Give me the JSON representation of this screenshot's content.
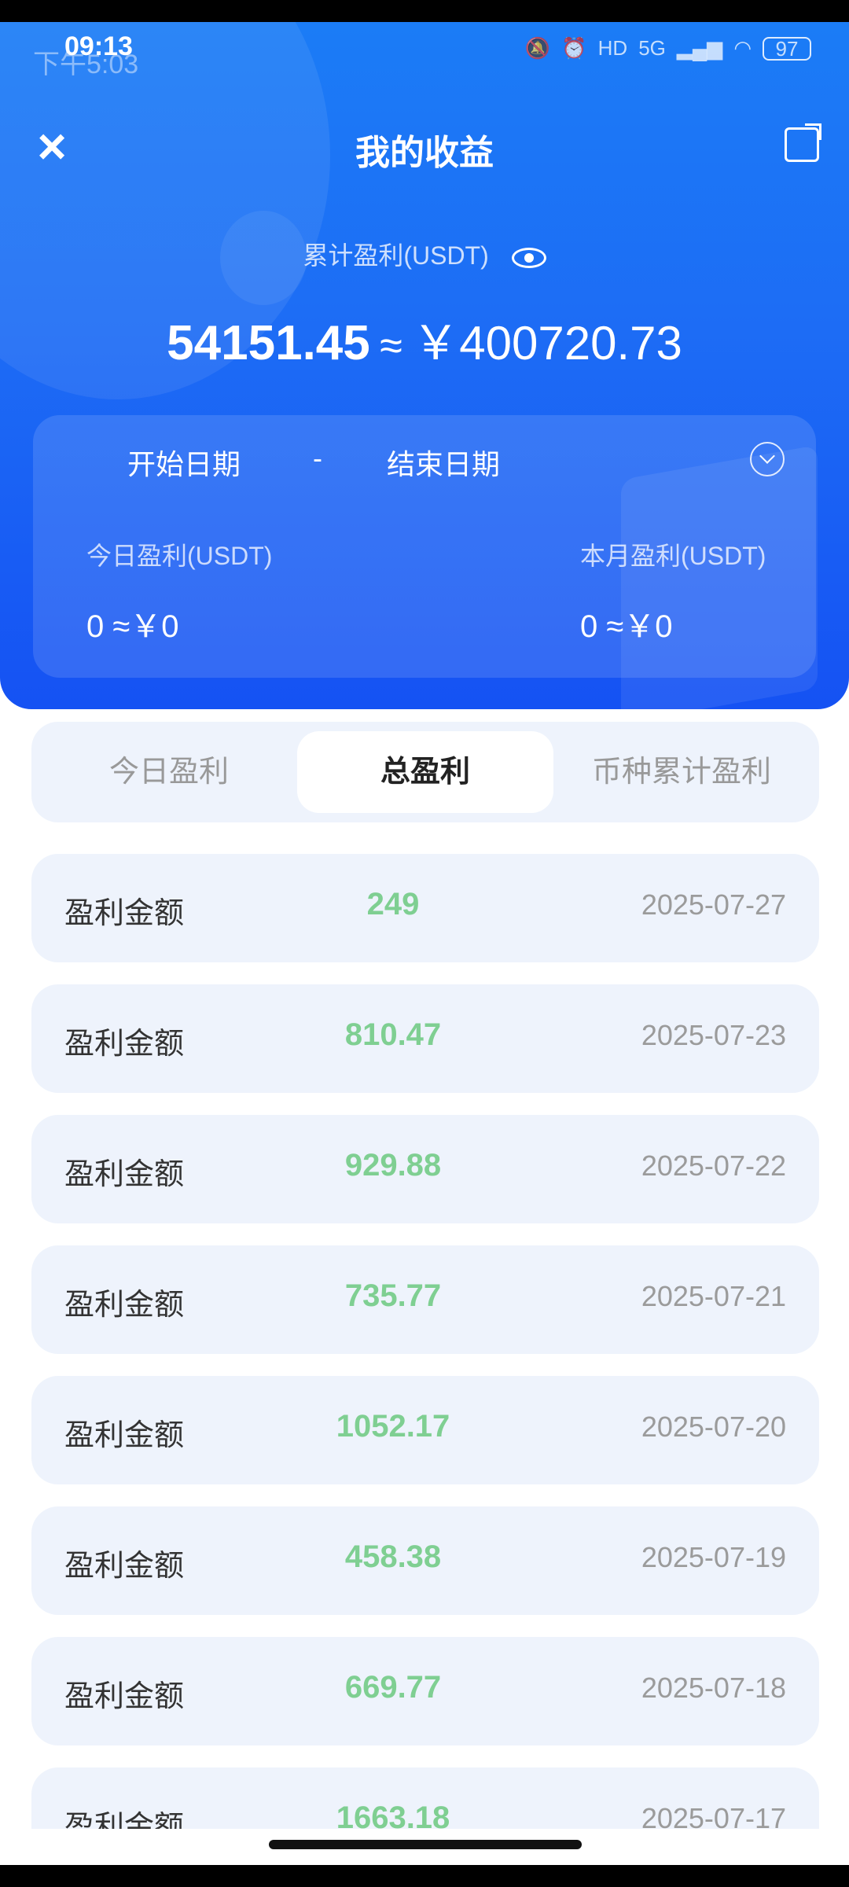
{
  "status_bar": {
    "time": "09:13",
    "ghost_time": "下午5:03",
    "network": "5G",
    "hd": "HD",
    "battery": "97"
  },
  "header": {
    "title": "我的收益",
    "close_icon": "close-icon",
    "share_icon": "share-icon"
  },
  "summary": {
    "cumulative_label": "累计盈利(USDT)",
    "cumulative_usdt": "54151.45",
    "approx": "≈",
    "cumulative_cny": "￥400720.73"
  },
  "filter": {
    "start_date": "开始日期",
    "separator": "-",
    "end_date": "结束日期"
  },
  "stats": {
    "today_label": "今日盈利(USDT)",
    "today_value": "0 ≈￥0",
    "month_label": "本月盈利(USDT)",
    "month_value": "0 ≈￥0"
  },
  "tabs": [
    {
      "label": "今日盈利",
      "active": false
    },
    {
      "label": "总盈利",
      "active": true
    },
    {
      "label": "币种累计盈利",
      "active": false
    }
  ],
  "rows": [
    {
      "label": "盈利金额",
      "amount": "249",
      "date": "2025-07-27"
    },
    {
      "label": "盈利金额",
      "amount": "810.47",
      "date": "2025-07-23"
    },
    {
      "label": "盈利金额",
      "amount": "929.88",
      "date": "2025-07-22"
    },
    {
      "label": "盈利金额",
      "amount": "735.77",
      "date": "2025-07-21"
    },
    {
      "label": "盈利金额",
      "amount": "1052.17",
      "date": "2025-07-20"
    },
    {
      "label": "盈利金额",
      "amount": "458.38",
      "date": "2025-07-19"
    },
    {
      "label": "盈利金额",
      "amount": "669.77",
      "date": "2025-07-18"
    },
    {
      "label": "盈利金额",
      "amount": "1663.18",
      "date": "2025-07-17"
    }
  ],
  "colors": {
    "primary": "#1b6ff5",
    "profit_green": "#7fcf92",
    "row_bg": "#eef3fc"
  }
}
